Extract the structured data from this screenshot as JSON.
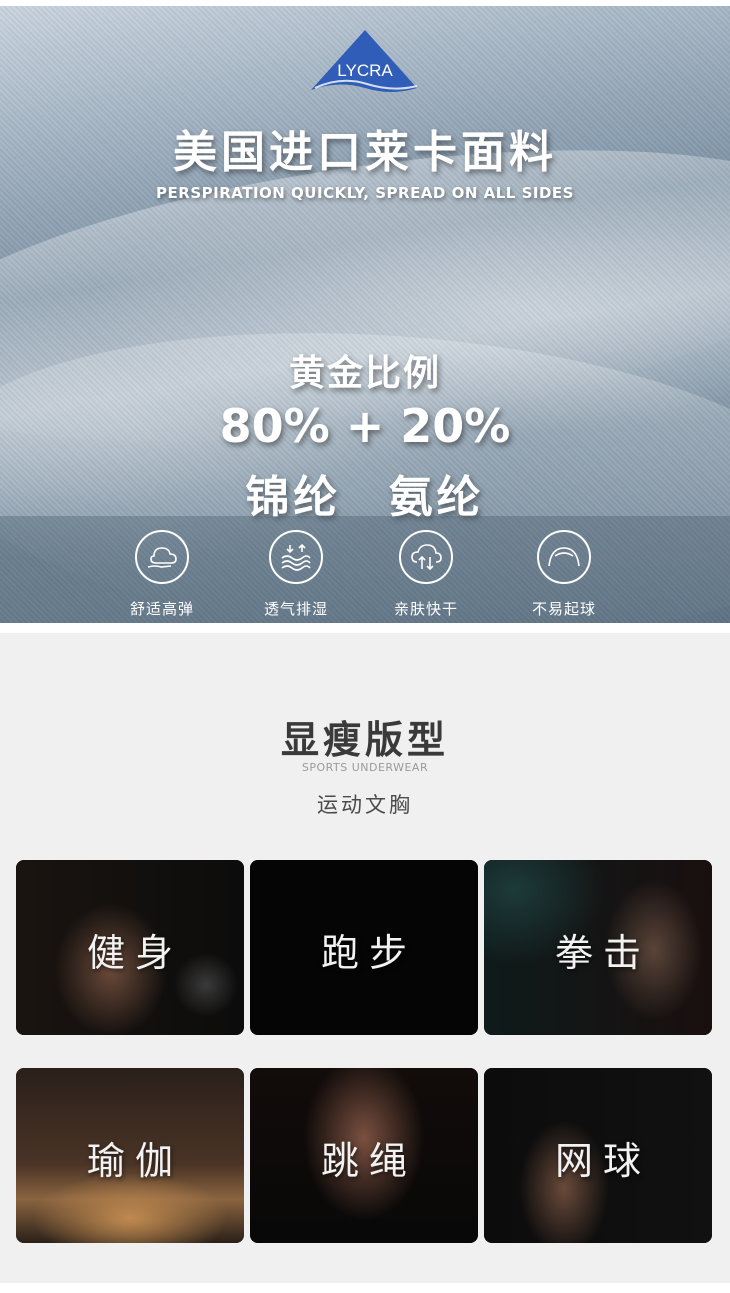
{
  "hero": {
    "logo_text": "LYCRA",
    "title": "美国进口莱卡面料",
    "subtitle": "PERSPIRATION QUICKLY, SPREAD ON ALL SIDES",
    "ratio_heading": "黄金比例",
    "ratio_value": "80% + 20%",
    "materials": "锦纶 氨纶",
    "features": [
      {
        "icon": "soft-cloud-hand-icon",
        "label": "舒适高弹"
      },
      {
        "icon": "breathable-wave-icon",
        "label": "透气排湿"
      },
      {
        "icon": "quick-dry-cloud-icon",
        "label": "亲肤快干"
      },
      {
        "icon": "anti-pilling-arc-icon",
        "label": "不易起球"
      }
    ]
  },
  "section": {
    "title": "显瘦版型",
    "subtitle": "SPORTS UNDERWEAR",
    "description": "运动文胸"
  },
  "cards": [
    {
      "label": "健身"
    },
    {
      "label": "跑步"
    },
    {
      "label": "拳击"
    },
    {
      "label": "瑜伽"
    },
    {
      "label": "跳绳"
    },
    {
      "label": "网球"
    }
  ],
  "colors": {
    "lycra_blue": "#2f5db8",
    "section_bg": "#f0f0f0",
    "card_bg": "#0a0a0a"
  }
}
